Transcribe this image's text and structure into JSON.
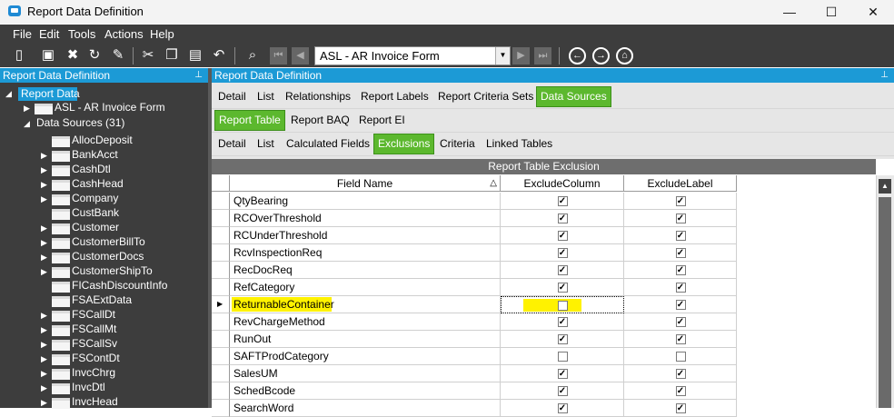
{
  "window": {
    "title": "Report Data Definition",
    "minimize": "—",
    "maximize": "☐",
    "close": "✕"
  },
  "menu": [
    "File",
    "Edit",
    "Tools",
    "Actions",
    "Help"
  ],
  "toolbar": {
    "combo_value": "ASL - AR Invoice Form"
  },
  "left_panel": {
    "header": "Report Data Definition",
    "root": "Report Data",
    "form_node": "ASL - AR Invoice Form",
    "data_sources": "Data Sources (31)",
    "items": [
      {
        "label": "AllocDeposit",
        "expandable": false
      },
      {
        "label": "BankAcct",
        "expandable": true
      },
      {
        "label": "CashDtl",
        "expandable": true
      },
      {
        "label": "CashHead",
        "expandable": true
      },
      {
        "label": "Company",
        "expandable": true
      },
      {
        "label": "CustBank",
        "expandable": false
      },
      {
        "label": "Customer",
        "expandable": true
      },
      {
        "label": "CustomerBillTo",
        "expandable": true
      },
      {
        "label": "CustomerDocs",
        "expandable": true
      },
      {
        "label": "CustomerShipTo",
        "expandable": true
      },
      {
        "label": "FICashDiscountInfo",
        "expandable": false
      },
      {
        "label": "FSAExtData",
        "expandable": false
      },
      {
        "label": "FSCallDt",
        "expandable": true
      },
      {
        "label": "FSCallMt",
        "expandable": true
      },
      {
        "label": "FSCallSv",
        "expandable": true
      },
      {
        "label": "FSContDt",
        "expandable": true
      },
      {
        "label": "InvcChrg",
        "expandable": true
      },
      {
        "label": "InvcDtl",
        "expandable": true
      },
      {
        "label": "InvcHead",
        "expandable": true
      }
    ]
  },
  "right_panel": {
    "header": "Report Data Definition",
    "tabs1": [
      "Detail",
      "List",
      "Relationships",
      "Report Labels",
      "Report Criteria Sets",
      "Data Sources"
    ],
    "tabs2": [
      "Report Table",
      "Report BAQ",
      "Report EI"
    ],
    "tabs3": [
      "Detail",
      "List",
      "Calculated Fields",
      "Exclusions",
      "Criteria",
      "Linked Tables"
    ]
  },
  "grid": {
    "title": "Report Table Exclusion",
    "columns": [
      "Field Name",
      "ExcludeColumn",
      "ExcludeLabel"
    ],
    "rows": [
      {
        "field": "QtyBearing",
        "exclude_column": true,
        "exclude_label": true
      },
      {
        "field": "RCOverThreshold",
        "exclude_column": true,
        "exclude_label": true
      },
      {
        "field": "RCUnderThreshold",
        "exclude_column": true,
        "exclude_label": true
      },
      {
        "field": "RcvInspectionReq",
        "exclude_column": true,
        "exclude_label": true
      },
      {
        "field": "RecDocReq",
        "exclude_column": true,
        "exclude_label": true
      },
      {
        "field": "RefCategory",
        "exclude_column": true,
        "exclude_label": true
      },
      {
        "field": "ReturnableContainer",
        "exclude_column": false,
        "exclude_label": true,
        "current": true
      },
      {
        "field": "RevChargeMethod",
        "exclude_column": true,
        "exclude_label": true
      },
      {
        "field": "RunOut",
        "exclude_column": true,
        "exclude_label": true
      },
      {
        "field": "SAFTProdCategory",
        "exclude_column": false,
        "exclude_label": false
      },
      {
        "field": "SalesUM",
        "exclude_column": true,
        "exclude_label": true
      },
      {
        "field": "SchedBcode",
        "exclude_column": true,
        "exclude_label": true
      },
      {
        "field": "SearchWord",
        "exclude_column": true,
        "exclude_label": true
      }
    ]
  }
}
